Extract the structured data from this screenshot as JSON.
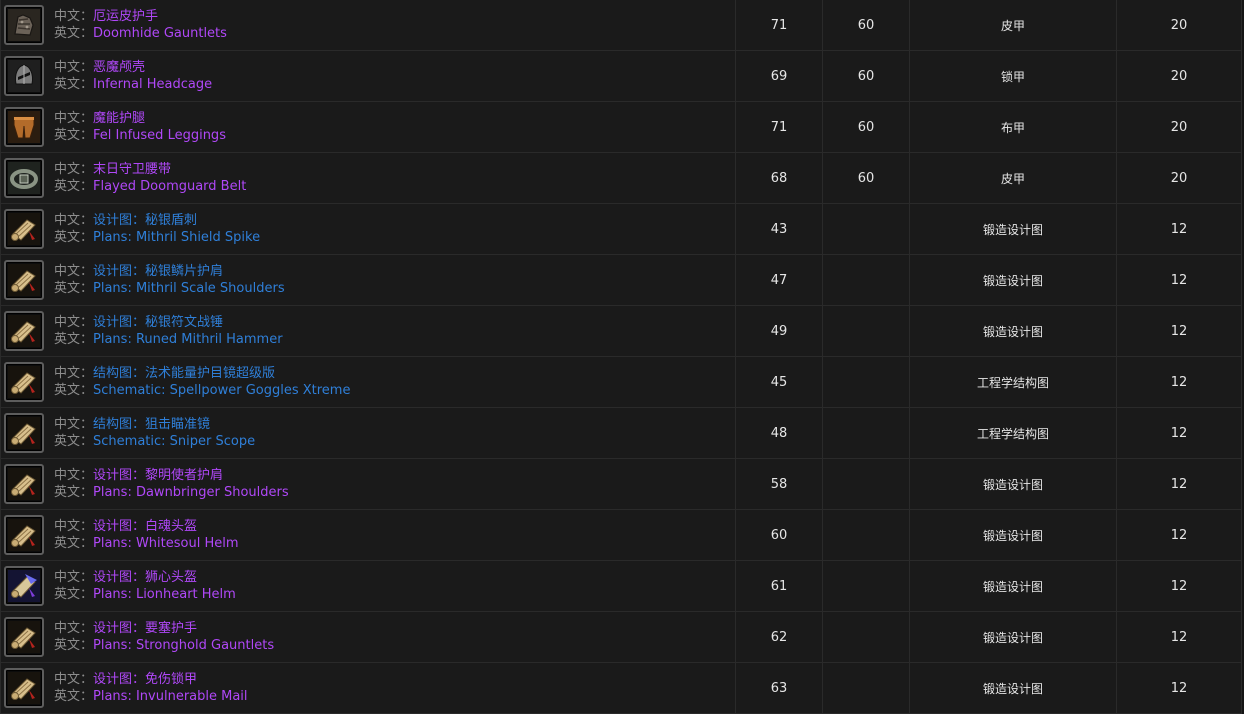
{
  "labels": {
    "cn": "中文：",
    "en": "英文："
  },
  "colors": {
    "background": "#151515",
    "epic": "#b048f8",
    "rare": "#2f7fd8",
    "label": "#8d8d8d",
    "text": "#e6e6e6"
  },
  "rows": [
    {
      "icon": "gauntlet-icon",
      "quality": "epic",
      "cn": "厄运皮护手",
      "en": "Doomhide Gauntlets",
      "level": "71",
      "req": "60",
      "type": "皮甲",
      "slot": "20"
    },
    {
      "icon": "helm-icon",
      "quality": "epic",
      "cn": "恶魔颅壳",
      "en": "Infernal Headcage",
      "level": "69",
      "req": "60",
      "type": "锁甲",
      "slot": "20"
    },
    {
      "icon": "leggings-icon",
      "quality": "epic",
      "cn": "魔能护腿",
      "en": "Fel Infused Leggings",
      "level": "71",
      "req": "60",
      "type": "布甲",
      "slot": "20"
    },
    {
      "icon": "belt-icon",
      "quality": "epic",
      "cn": "末日守卫腰带",
      "en": "Flayed Doomguard Belt",
      "level": "68",
      "req": "60",
      "type": "皮甲",
      "slot": "20"
    },
    {
      "icon": "scroll-icon",
      "quality": "rare",
      "cn": "设计图：秘银盾刺",
      "en": "Plans: Mithril Shield Spike",
      "level": "43",
      "req": "",
      "type": "锻造设计图",
      "slot": "12"
    },
    {
      "icon": "scroll-icon",
      "quality": "rare",
      "cn": "设计图：秘银鳞片护肩",
      "en": "Plans: Mithril Scale Shoulders",
      "level": "47",
      "req": "",
      "type": "锻造设计图",
      "slot": "12"
    },
    {
      "icon": "scroll-icon",
      "quality": "rare",
      "cn": "设计图：秘银符文战锤",
      "en": "Plans: Runed Mithril Hammer",
      "level": "49",
      "req": "",
      "type": "锻造设计图",
      "slot": "12"
    },
    {
      "icon": "scroll-icon",
      "quality": "rare",
      "cn": "结构图：法术能量护目镜超级版",
      "en": "Schematic: Spellpower Goggles Xtreme",
      "level": "45",
      "req": "",
      "type": "工程学结构图",
      "slot": "12"
    },
    {
      "icon": "scroll-icon",
      "quality": "rare",
      "cn": "结构图：狙击瞄准镜",
      "en": "Schematic: Sniper Scope",
      "level": "48",
      "req": "",
      "type": "工程学结构图",
      "slot": "12"
    },
    {
      "icon": "scroll-icon",
      "quality": "epic",
      "cn": "设计图：黎明使者护肩",
      "en": "Plans: Dawnbringer Shoulders",
      "level": "58",
      "req": "",
      "type": "锻造设计图",
      "slot": "12"
    },
    {
      "icon": "scroll-icon",
      "quality": "epic",
      "cn": "设计图：白魂头盔",
      "en": "Plans: Whitesoul Helm",
      "level": "60",
      "req": "",
      "type": "锻造设计图",
      "slot": "12"
    },
    {
      "icon": "scroll-blue-icon",
      "quality": "epic",
      "cn": "设计图：狮心头盔",
      "en": "Plans: Lionheart Helm",
      "level": "61",
      "req": "",
      "type": "锻造设计图",
      "slot": "12"
    },
    {
      "icon": "scroll-icon",
      "quality": "epic",
      "cn": "设计图：要塞护手",
      "en": "Plans: Stronghold Gauntlets",
      "level": "62",
      "req": "",
      "type": "锻造设计图",
      "slot": "12"
    },
    {
      "icon": "scroll-icon",
      "quality": "epic",
      "cn": "设计图：免伤锁甲",
      "en": "Plans: Invulnerable Mail",
      "level": "63",
      "req": "",
      "type": "锻造设计图",
      "slot": "12"
    }
  ]
}
